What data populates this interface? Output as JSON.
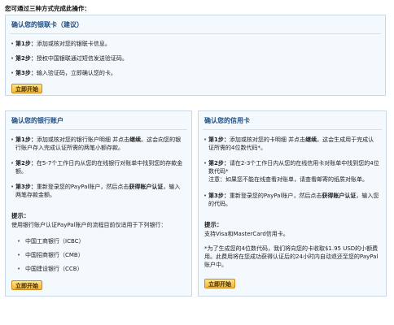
{
  "intro": "您可通过三种方式完成此操作：",
  "debit": {
    "title": "确认您的银联卡（建议）",
    "steps": [
      {
        "label": "第1步：",
        "text": "添加或核对您的银联卡信息。"
      },
      {
        "label": "第2步：",
        "text": "授权中国银联通过短信发送验证码。"
      },
      {
        "label": "第3步：",
        "text": "输入验证码，立即确认您的卡。"
      }
    ],
    "button": "立即开始"
  },
  "bank": {
    "title": "确认您的银行账户",
    "step1_label": "第1步：",
    "step1_text_a": "添加或核对您的银行账户明细 并点击",
    "step1_bold": "继续",
    "step1_text_b": "。这会向您的银行账户存入完成认证所需的两笔小额存款。",
    "step2_label": "第2步：",
    "step2_text": "在5-7个工作日内从您的在线银行对账单中找到您的存款金额。",
    "step3_label": "第3步：",
    "step3_text_a": "重新登录您的PayPal账户，然后点击",
    "step3_bold": "获得账户认证",
    "step3_text_b": "，输入两笔存款金额。",
    "tip_title": "提示：",
    "tip_text": "使用银行账户认证PayPal账户的流程目前仅适用于下列银行：",
    "banks": [
      "中国工商银行（ICBC）",
      "中国招商银行（CMB）",
      "中国建设银行（CCB）"
    ],
    "button": "立即开始"
  },
  "card": {
    "title": "确认您的信用卡",
    "step1_label": "第1步：",
    "step1_text_a": "添加或核对您的卡明细 并点击",
    "step1_bold": "继续",
    "step1_text_b": "。这会生成用于完成认证所需的4位数代码",
    "step1_tail": "*。",
    "step2_label": "第2步：",
    "step2_text": "请在2-3个工作日内从您的在线信用卡对账单中找到您的4位数代码",
    "step2_tail": "*",
    "step2_note": "注意：如果您不能在线查看对账单，请查看邮寄的纸质对账单。",
    "step3_label": "第3步：",
    "step3_text_a": "重新登录您的PayPal账户，然后点击",
    "step3_bold": "获得账户认证",
    "step3_text_b": "，输入您的代码。",
    "tip_title": "提示：",
    "tip_text1": "支持Visa和MasterCard信用卡。",
    "tip_text2": "*为了生成您的4位数代码，我们将向您的卡收取$1.95 USD的小额费用。此费用将在您成功获得认证后的24小时内自动退还至您的PayPal账户中。",
    "button": "立即开始"
  }
}
